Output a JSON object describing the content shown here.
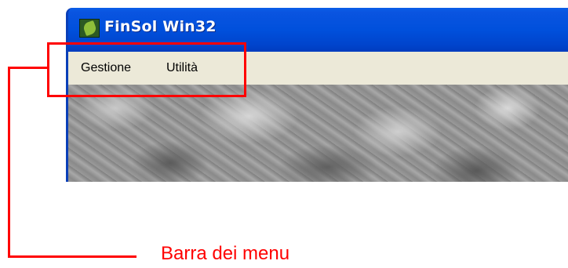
{
  "window": {
    "title": "FinSol Win32",
    "app_icon": "finsol-leaf-icon"
  },
  "menubar": {
    "items": [
      {
        "label": "Gestione"
      },
      {
        "label": "Utilità"
      }
    ]
  },
  "annotation": {
    "label": "Barra dei menu",
    "color": "#ff0000"
  },
  "colors": {
    "titlebar": "#0050dc",
    "menubar": "#ece9d8",
    "title_text": "#ffffff"
  }
}
